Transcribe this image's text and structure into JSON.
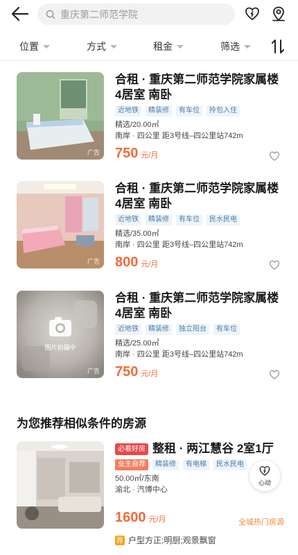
{
  "search": {
    "placeholder": "重庆第二师范学院"
  },
  "filters": [
    {
      "label": "位置"
    },
    {
      "label": "方式"
    },
    {
      "label": "租金"
    },
    {
      "label": "筛选"
    }
  ],
  "listings": [
    {
      "title": "合租 · 重庆第二师范学院家属楼4居室 南卧",
      "tags": [
        "近地铁",
        "精装修",
        "有车位",
        "拎包入住"
      ],
      "area": "精选/20.00㎡",
      "location": "南岸 · 四公里 距3号线–四公里站742m",
      "price": "750",
      "unit": "元/月",
      "ad": "广告"
    },
    {
      "title": "合租 · 重庆第二师范学院家属楼4居室 南卧",
      "tags": [
        "近地铁",
        "精装修",
        "有车位",
        "民水民电"
      ],
      "area": "精选/35.00㎡",
      "location": "南岸 · 四公里 距3号线–四公里站742m",
      "price": "800",
      "unit": "元/月",
      "ad": "广告"
    },
    {
      "title": "合租 · 重庆第二师范学院家属楼4居室 南卧",
      "tags": [
        "近地铁",
        "精装修",
        "独立阳台",
        "有车位"
      ],
      "area": "精选/25.00㎡",
      "location": "南岸 · 四公里 距3号线–四公里站742m",
      "price": "750",
      "unit": "元/月",
      "ad": "广告",
      "placeholder_text": "图片拍摄中"
    }
  ],
  "recommend": {
    "section_title": "为您推荐相似条件的房源",
    "badge": "必看好房",
    "title": "整租 · 两江慧谷 2室1厅",
    "tag_owner": "业主自荐",
    "tags": [
      "精装修",
      "有电梯",
      "民水民电"
    ],
    "area": "50.00㎡/东南",
    "location": "渝北 · 汽博中心",
    "price": "1600",
    "unit": "元/月",
    "hot": "全城热门房源",
    "xindong": "心动",
    "feature_icon": "荐",
    "feature": "户型方正;明厨;观景飘窗"
  },
  "colors": {
    "price": "#f26b3a",
    "tag_text": "#4d7ea8",
    "badge_red": "#e8484b"
  }
}
